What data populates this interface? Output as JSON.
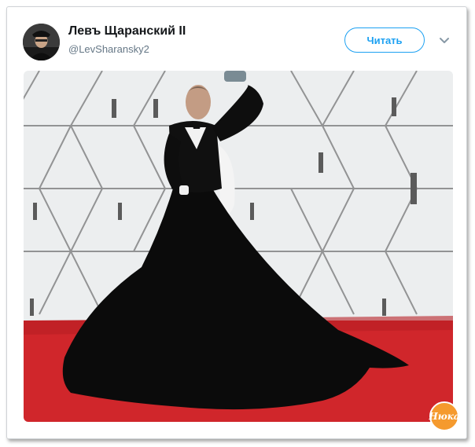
{
  "tweet": {
    "author_name": "Левъ Щаранский II",
    "author_handle": "@LevSharansky2",
    "follow_label": "Читать",
    "menu_icon": "chevron-down-icon",
    "avatar_icon": "avatar-portrait",
    "media": {
      "description_icon": "photo",
      "colors": {
        "carpet": "#d0262b",
        "dress": "#0b0b0b",
        "backdrop": "#eceeef"
      }
    }
  },
  "watermark": {
    "label": "Нюка"
  },
  "colors": {
    "accent": "#1da1f2",
    "name": "#14171a",
    "handle": "#657786"
  }
}
